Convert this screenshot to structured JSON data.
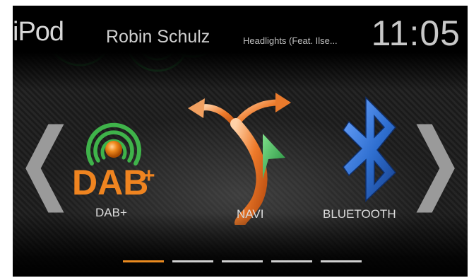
{
  "header": {
    "source": "iPod",
    "artist": "Robin Schulz",
    "track": "Headlights (Feat. Ilse...",
    "clock": "11:05"
  },
  "apps": [
    {
      "label": "DAB+",
      "icon": "dab-radio-icon",
      "icon_text": "DAB",
      "icon_plus": "+"
    },
    {
      "label": "NAVI",
      "icon": "navigation-arrows-icon"
    },
    {
      "label": "BLUETOOTH",
      "icon": "bluetooth-icon"
    }
  ],
  "nav": {
    "prev": "❮",
    "next": "❯"
  },
  "pager": {
    "count": 5,
    "active_index": 0
  },
  "colors": {
    "accent_orange": "#e98a20",
    "dab_green": "#3fb34a",
    "bluetooth_blue": "#2f6fd0",
    "navi_orange": "#e5772a",
    "navi_green": "#2ea44a"
  }
}
